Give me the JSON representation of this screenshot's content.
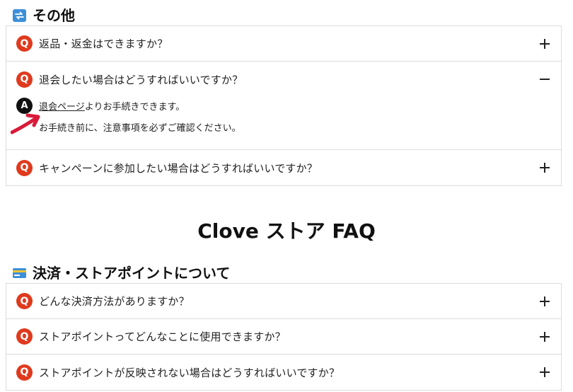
{
  "section1": {
    "title": "その他",
    "icon": "refresh-icon",
    "items": [
      {
        "badge": "Q",
        "question": "返品・返金はできますか？",
        "state": "collapsed"
      },
      {
        "badge": "Q",
        "question": "退会したい場合はどうすればいいですか？",
        "state": "expanded",
        "answer_badge": "A",
        "answer_link": "退会ページ",
        "answer_rest": "よりお手続きできます。",
        "answer_note": "お手続き前に、注意事項を必ずご確認ください。"
      },
      {
        "badge": "Q",
        "question": "キャンペーンに参加したい場合はどうすればいいですか？",
        "state": "collapsed"
      }
    ]
  },
  "store_title": "Clove ストア FAQ",
  "section2": {
    "title": "決済・ストアポイントについて",
    "icon": "credit-card-icon",
    "items": [
      {
        "badge": "Q",
        "question": "どんな決済方法がありますか？"
      },
      {
        "badge": "Q",
        "question": "ストアポイントってどんなことに使用できますか？"
      },
      {
        "badge": "Q",
        "question": "ストアポイントが反映されない場合はどうすればいいですか？"
      }
    ]
  },
  "colors": {
    "q_badge": "#e03a1e",
    "a_badge": "#111111",
    "arrow": "#d81b3a",
    "border": "#dcdcdc"
  }
}
